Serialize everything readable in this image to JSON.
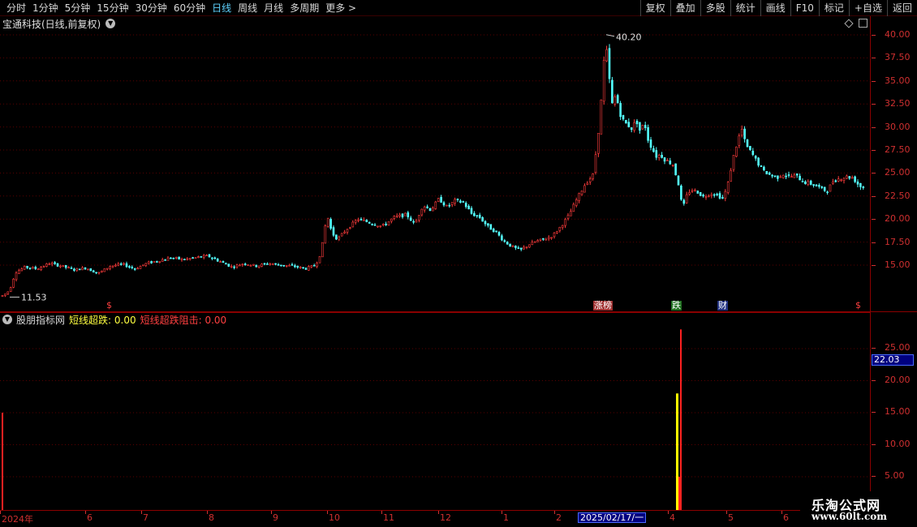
{
  "toolbar": {
    "periods": [
      {
        "label": "分时",
        "active": false
      },
      {
        "label": "1分钟",
        "active": false
      },
      {
        "label": "5分钟",
        "active": false
      },
      {
        "label": "15分钟",
        "active": false
      },
      {
        "label": "30分钟",
        "active": false
      },
      {
        "label": "60分钟",
        "active": false
      },
      {
        "label": "日线",
        "active": true
      },
      {
        "label": "周线",
        "active": false
      },
      {
        "label": "月线",
        "active": false
      },
      {
        "label": "多周期",
        "active": false
      },
      {
        "label": "更多 >",
        "active": false
      }
    ],
    "buttons": [
      "复权",
      "叠加",
      "多股",
      "统计",
      "画线",
      "F10",
      "标记",
      "+自选",
      "返回"
    ]
  },
  "chart": {
    "title": "宝通科技(日线,前复权)",
    "high_label": "40.20",
    "low_label": "11.53",
    "price_axis": [
      "40.00",
      "37.50",
      "35.00",
      "32.50",
      "30.00",
      "27.50",
      "25.00",
      "22.50",
      "20.00",
      "17.50",
      "15.00"
    ],
    "events": [
      {
        "label": "$",
        "kind": "dollar"
      },
      {
        "label": "涨榜",
        "kind": "rise"
      },
      {
        "label": "跌",
        "kind": "fall"
      },
      {
        "label": "财",
        "kind": "fin"
      },
      {
        "label": "$",
        "kind": "dollar"
      }
    ]
  },
  "indicator": {
    "name": "股朋指标网",
    "line_a": "短线超跌: 0.00",
    "line_b": "短线超跌阻击: 0.00",
    "axis": [
      "25.00",
      "20.00",
      "15.00",
      "10.00",
      "5.00"
    ],
    "current_value": "22.03"
  },
  "time_axis": {
    "labels": [
      "2024年",
      "6",
      "7",
      "8",
      "9",
      "10",
      "11",
      "12",
      "1",
      "2",
      "4",
      "5",
      "6"
    ],
    "cursor_date": "2025/02/17/一"
  },
  "watermark": {
    "title": "乐淘公式网",
    "url": "www.60lt.com"
  },
  "colors": {
    "up": "#ff3c3c",
    "down": "#54ffff",
    "axis": "#d03030",
    "grid": "#5a0000",
    "yellow": "#ffff00"
  },
  "chart_data": {
    "type": "candlestick",
    "title": "宝通科技(日线,前复权)",
    "ylim": [
      10.5,
      41.5
    ],
    "high": 40.2,
    "low": 11.53,
    "price_path": [
      [
        0,
        11.6
      ],
      [
        8,
        12.0
      ],
      [
        12,
        12.6
      ],
      [
        18,
        14.2
      ],
      [
        30,
        14.8
      ],
      [
        45,
        14.6
      ],
      [
        60,
        15.2
      ],
      [
        75,
        14.9
      ],
      [
        90,
        14.5
      ],
      [
        105,
        14.7
      ],
      [
        120,
        14.1
      ],
      [
        135,
        14.9
      ],
      [
        150,
        15.1
      ],
      [
        165,
        14.6
      ],
      [
        180,
        15.2
      ],
      [
        195,
        15.5
      ],
      [
        210,
        15.8
      ],
      [
        225,
        15.6
      ],
      [
        240,
        15.8
      ],
      [
        255,
        16.0
      ],
      [
        270,
        15.4
      ],
      [
        285,
        14.8
      ],
      [
        300,
        15.2
      ],
      [
        315,
        14.9
      ],
      [
        330,
        15.2
      ],
      [
        345,
        15.0
      ],
      [
        360,
        14.9
      ],
      [
        375,
        14.6
      ],
      [
        388,
        15.0
      ],
      [
        395,
        16.5
      ],
      [
        402,
        20.5
      ],
      [
        408,
        18.5
      ],
      [
        415,
        17.8
      ],
      [
        425,
        18.8
      ],
      [
        440,
        20.0
      ],
      [
        455,
        19.6
      ],
      [
        470,
        19.2
      ],
      [
        485,
        20.2
      ],
      [
        500,
        20.5
      ],
      [
        510,
        19.4
      ],
      [
        520,
        21.5
      ],
      [
        530,
        21.0
      ],
      [
        540,
        22.2
      ],
      [
        550,
        21.3
      ],
      [
        560,
        22.0
      ],
      [
        570,
        21.8
      ],
      [
        580,
        20.6
      ],
      [
        590,
        20.2
      ],
      [
        600,
        19.2
      ],
      [
        610,
        18.6
      ],
      [
        620,
        17.6
      ],
      [
        630,
        17.0
      ],
      [
        640,
        16.6
      ],
      [
        650,
        17.2
      ],
      [
        660,
        17.6
      ],
      [
        670,
        17.8
      ],
      [
        680,
        18.2
      ],
      [
        690,
        19.2
      ],
      [
        700,
        20.4
      ],
      [
        710,
        22.2
      ],
      [
        720,
        23.8
      ],
      [
        730,
        24.8
      ],
      [
        737,
        30.0
      ],
      [
        741,
        34.0
      ],
      [
        745,
        39.6
      ],
      [
        749,
        36.0
      ],
      [
        753,
        32.4
      ],
      [
        758,
        33.5
      ],
      [
        763,
        31.5
      ],
      [
        768,
        30.5
      ],
      [
        773,
        30.2
      ],
      [
        778,
        29.8
      ],
      [
        783,
        30.8
      ],
      [
        788,
        29.5
      ],
      [
        793,
        30.5
      ],
      [
        798,
        28.5
      ],
      [
        803,
        27.6
      ],
      [
        808,
        26.8
      ],
      [
        813,
        27.0
      ],
      [
        818,
        26.5
      ],
      [
        823,
        26.2
      ],
      [
        828,
        26.0
      ],
      [
        836,
        23.5
      ],
      [
        840,
        21.0
      ],
      [
        845,
        22.5
      ],
      [
        850,
        23.2
      ],
      [
        858,
        23.0
      ],
      [
        866,
        22.4
      ],
      [
        874,
        22.8
      ],
      [
        882,
        22.7
      ],
      [
        890,
        22.2
      ],
      [
        896,
        23.8
      ],
      [
        902,
        26.5
      ],
      [
        908,
        28.5
      ],
      [
        913,
        29.8
      ],
      [
        918,
        28.0
      ],
      [
        925,
        27.2
      ],
      [
        932,
        26.2
      ],
      [
        940,
        25.2
      ],
      [
        948,
        24.8
      ],
      [
        956,
        24.5
      ],
      [
        964,
        24.9
      ],
      [
        972,
        24.6
      ],
      [
        980,
        24.7
      ],
      [
        990,
        24.0
      ],
      [
        1000,
        23.8
      ],
      [
        1010,
        23.4
      ],
      [
        1018,
        23.0
      ],
      [
        1026,
        24.2
      ],
      [
        1034,
        24.4
      ],
      [
        1042,
        24.6
      ],
      [
        1050,
        24.5
      ],
      [
        1058,
        23.6
      ],
      [
        1064,
        23.4
      ]
    ],
    "indicator_bars": [
      {
        "x": 2,
        "red": 15.0
      },
      {
        "x": 833,
        "yellow": 18.0,
        "red": 5.0
      },
      {
        "x": 838,
        "red": 28.0
      }
    ]
  }
}
